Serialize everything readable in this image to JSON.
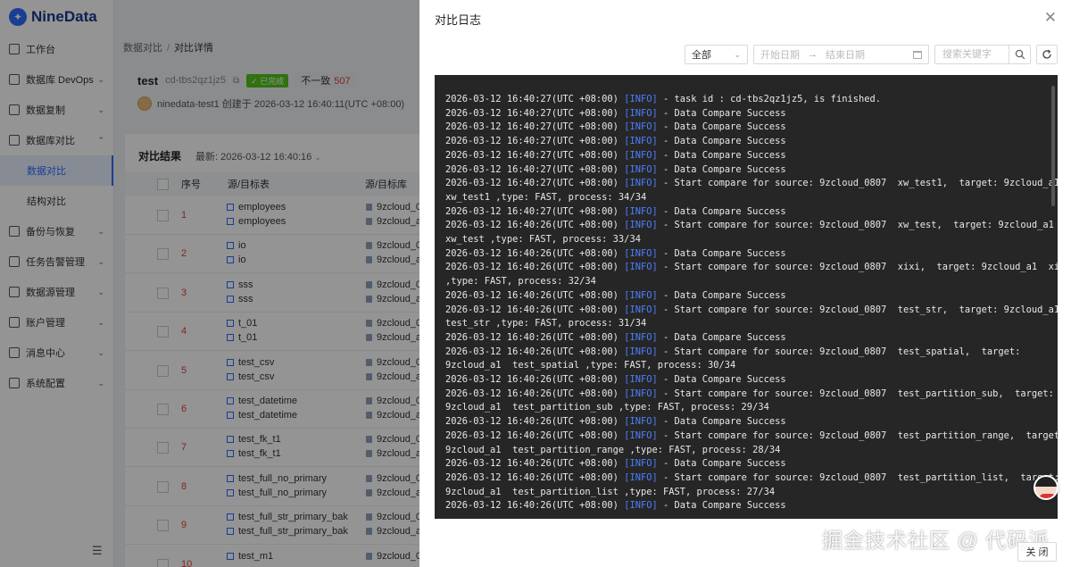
{
  "app": {
    "logo_text": "NineData"
  },
  "sidebar": {
    "items": [
      {
        "label": "工作台",
        "icon": "home-icon",
        "chevron": ""
      },
      {
        "label": "数据库 DevOps",
        "icon": "terminal-icon",
        "chevron": "⌄"
      },
      {
        "label": "数据复制",
        "icon": "copy-icon",
        "chevron": "⌄"
      },
      {
        "label": "数据库对比",
        "icon": "compare-icon",
        "chevron": "⌃"
      }
    ],
    "sub_items": [
      {
        "label": "数据对比",
        "active": true
      },
      {
        "label": "结构对比",
        "active": false
      }
    ],
    "more_items": [
      {
        "label": "备份与恢复",
        "icon": "backup-icon",
        "chevron": "⌄"
      },
      {
        "label": "任务告警管理",
        "icon": "alert-icon",
        "chevron": "⌄"
      },
      {
        "label": "数据源管理",
        "icon": "datasource-icon",
        "chevron": "⌄"
      },
      {
        "label": "账户管理",
        "icon": "account-icon",
        "chevron": "⌄"
      },
      {
        "label": "消息中心",
        "icon": "message-icon",
        "chevron": "⌄"
      },
      {
        "label": "系统配置",
        "icon": "settings-icon",
        "chevron": "⌄"
      }
    ]
  },
  "breadcrumb": {
    "parent": "数据对比",
    "separator": "/",
    "current": "对比详情"
  },
  "task": {
    "name": "test",
    "id": "cd-tbs2qz1jz5",
    "status": "已完成",
    "diff_label": "不一致",
    "diff_count": "507",
    "creator_text": "ninedata-test1 创建于 2026-03-12 16:40:11(UTC +08:00)"
  },
  "results": {
    "title": "对比结果",
    "latest": "最新:  2026-03-12 16:40:16",
    "columns": {
      "seq": "序号",
      "table": "源/目标表",
      "db": "源/目标库"
    },
    "rows": [
      {
        "seq": "1",
        "src": "employees",
        "dst": "employees",
        "src_db": "9zcloud_0",
        "dst_db": "9zcloud_a"
      },
      {
        "seq": "2",
        "src": "io",
        "dst": "io",
        "src_db": "9zcloud_0",
        "dst_db": "9zcloud_a"
      },
      {
        "seq": "3",
        "src": "sss",
        "dst": "sss",
        "src_db": "9zcloud_0",
        "dst_db": "9zcloud_a"
      },
      {
        "seq": "4",
        "src": "t_01",
        "dst": "t_01",
        "src_db": "9zcloud_0",
        "dst_db": "9zcloud_a"
      },
      {
        "seq": "5",
        "src": "test_csv",
        "dst": "test_csv",
        "src_db": "9zcloud_0",
        "dst_db": "9zcloud_a"
      },
      {
        "seq": "6",
        "src": "test_datetime",
        "dst": "test_datetime",
        "src_db": "9zcloud_0",
        "dst_db": "9zcloud_a"
      },
      {
        "seq": "7",
        "src": "test_fk_t1",
        "dst": "test_fk_t1",
        "src_db": "9zcloud_0",
        "dst_db": "9zcloud_a"
      },
      {
        "seq": "8",
        "src": "test_full_no_primary",
        "dst": "test_full_no_primary",
        "src_db": "9zcloud_0",
        "dst_db": "9zcloud_a"
      },
      {
        "seq": "9",
        "src": "test_full_str_primary_bak",
        "dst": "test_full_str_primary_bak",
        "src_db": "9zcloud_0",
        "dst_db": "9zcloud_a"
      },
      {
        "seq": "10",
        "src": "test_m1",
        "dst": "",
        "src_db": "9zcloud_0",
        "dst_db": ""
      }
    ]
  },
  "drawer": {
    "title": "对比日志",
    "close_icon": "close-icon",
    "filter": {
      "level_value": "全部",
      "start_placeholder": "开始日期",
      "range_arrow": "→",
      "end_placeholder": "结束日期",
      "search_placeholder": "搜索关键字"
    },
    "logs": [
      {
        "ts": "2026-03-12 16:40:27(UTC +08:00)",
        "level": "[INFO]",
        "msg": "- task id : cd-tbs2qz1jz5, is finished."
      },
      {
        "ts": "2026-03-12 16:40:27(UTC +08:00)",
        "level": "[INFO]",
        "msg": "- Data Compare Success"
      },
      {
        "ts": "2026-03-12 16:40:27(UTC +08:00)",
        "level": "[INFO]",
        "msg": "- Data Compare Success"
      },
      {
        "ts": "2026-03-12 16:40:27(UTC +08:00)",
        "level": "[INFO]",
        "msg": "- Data Compare Success"
      },
      {
        "ts": "2026-03-12 16:40:27(UTC +08:00)",
        "level": "[INFO]",
        "msg": "- Data Compare Success"
      },
      {
        "ts": "2026-03-12 16:40:27(UTC +08:00)",
        "level": "[INFO]",
        "msg": "- Data Compare Success"
      },
      {
        "ts": "2026-03-12 16:40:27(UTC +08:00)",
        "level": "[INFO]",
        "msg": "- Start compare for source: 9zcloud_0807  xw_test1,  target: 9zcloud_a1"
      },
      {
        "ts": "",
        "level": "",
        "msg": "xw_test1 ,type: FAST, process: 34/34"
      },
      {
        "ts": "2026-03-12 16:40:27(UTC +08:00)",
        "level": "[INFO]",
        "msg": "- Data Compare Success"
      },
      {
        "ts": "2026-03-12 16:40:26(UTC +08:00)",
        "level": "[INFO]",
        "msg": "- Start compare for source: 9zcloud_0807  xw_test,  target: 9zcloud_a1"
      },
      {
        "ts": "",
        "level": "",
        "msg": "xw_test ,type: FAST, process: 33/34"
      },
      {
        "ts": "2026-03-12 16:40:26(UTC +08:00)",
        "level": "[INFO]",
        "msg": "- Data Compare Success"
      },
      {
        "ts": "2026-03-12 16:40:26(UTC +08:00)",
        "level": "[INFO]",
        "msg": "- Start compare for source: 9zcloud_0807  xixi,  target: 9zcloud_a1  xixi"
      },
      {
        "ts": "",
        "level": "",
        "msg": ",type: FAST, process: 32/34"
      },
      {
        "ts": "2026-03-12 16:40:26(UTC +08:00)",
        "level": "[INFO]",
        "msg": "- Data Compare Success"
      },
      {
        "ts": "2026-03-12 16:40:26(UTC +08:00)",
        "level": "[INFO]",
        "msg": "- Start compare for source: 9zcloud_0807  test_str,  target: 9zcloud_a1"
      },
      {
        "ts": "",
        "level": "",
        "msg": "test_str ,type: FAST, process: 31/34"
      },
      {
        "ts": "2026-03-12 16:40:26(UTC +08:00)",
        "level": "[INFO]",
        "msg": "- Data Compare Success"
      },
      {
        "ts": "2026-03-12 16:40:26(UTC +08:00)",
        "level": "[INFO]",
        "msg": "- Start compare for source: 9zcloud_0807  test_spatial,  target:"
      },
      {
        "ts": "",
        "level": "",
        "msg": "9zcloud_a1  test_spatial ,type: FAST, process: 30/34"
      },
      {
        "ts": "2026-03-12 16:40:26(UTC +08:00)",
        "level": "[INFO]",
        "msg": "- Data Compare Success"
      },
      {
        "ts": "2026-03-12 16:40:26(UTC +08:00)",
        "level": "[INFO]",
        "msg": "- Start compare for source: 9zcloud_0807  test_partition_sub,  target:"
      },
      {
        "ts": "",
        "level": "",
        "msg": "9zcloud_a1  test_partition_sub ,type: FAST, process: 29/34"
      },
      {
        "ts": "2026-03-12 16:40:26(UTC +08:00)",
        "level": "[INFO]",
        "msg": "- Data Compare Success"
      },
      {
        "ts": "2026-03-12 16:40:26(UTC +08:00)",
        "level": "[INFO]",
        "msg": "- Start compare for source: 9zcloud_0807  test_partition_range,  target:"
      },
      {
        "ts": "",
        "level": "",
        "msg": "9zcloud_a1  test_partition_range ,type: FAST, process: 28/34"
      },
      {
        "ts": "2026-03-12 16:40:26(UTC +08:00)",
        "level": "[INFO]",
        "msg": "- Data Compare Success"
      },
      {
        "ts": "2026-03-12 16:40:26(UTC +08:00)",
        "level": "[INFO]",
        "msg": "- Start compare for source: 9zcloud_0807  test_partition_list,  target:"
      },
      {
        "ts": "",
        "level": "",
        "msg": "9zcloud_a1  test_partition_list ,type: FAST, process: 27/34"
      },
      {
        "ts": "2026-03-12 16:40:26(UTC +08:00)",
        "level": "[INFO]",
        "msg": "- Data Compare Success"
      }
    ]
  },
  "watermark": "掘金技术社区 @ 代码派",
  "footer": {
    "close_label": "关 闭"
  },
  "colors": {
    "accent": "#2b6cff",
    "success": "#52c41a",
    "danger": "#e03e3e",
    "log_bg": "#262626",
    "log_level": "#4c7fff"
  }
}
